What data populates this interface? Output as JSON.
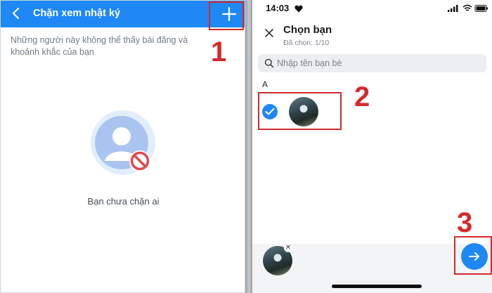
{
  "left_panel": {
    "title": "Chặn xem nhật ký",
    "description": "Những người này không thể thấy bài đăng và khoảnh khắc của bạn",
    "empty_text": "Bạn chưa chặn ai",
    "header_color": "#1e88f4",
    "icons": {
      "back": "chevron-left-icon",
      "add": "plus-icon",
      "illustration": "blocked-user-icon"
    }
  },
  "right_panel": {
    "status_bar": {
      "time": "14:03"
    },
    "title": "Chọn bạn",
    "subtitle": "Đã chọn: 1/10",
    "search": {
      "placeholder": "Nhập tên bạn bè"
    },
    "section_letter": "A",
    "icons": {
      "close": "close-icon",
      "search": "search-icon",
      "check": "check-icon",
      "send": "arrow-right-icon"
    },
    "accent_color": "#1e88f4"
  },
  "annotations": {
    "labels": [
      "1",
      "2",
      "3"
    ],
    "color": "#d42a2a"
  }
}
